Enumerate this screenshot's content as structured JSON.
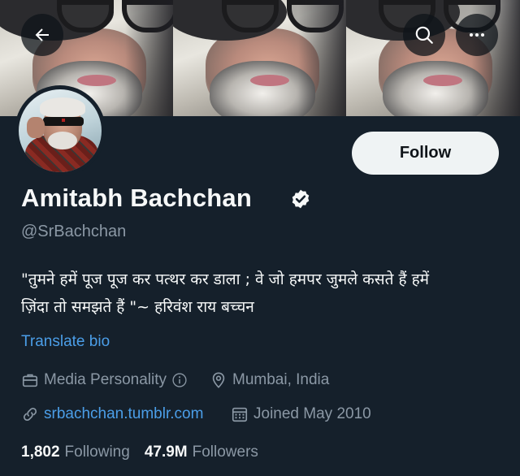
{
  "header": {
    "back_icon": "arrow-left-icon",
    "search_icon": "search-icon",
    "more_icon": "more-horizontal-icon"
  },
  "profile": {
    "follow_label": "Follow",
    "name": "Amitabh Bachchan",
    "verified": true,
    "handle": "@SrBachchan",
    "bio_line1": "\"तुमने हमें पूज पूज कर पत्थर कर डाला ; वे जो हमपर जुमले कसते हैं हमें",
    "bio_line2": "ज़िंदा तो समझते हैं \"~ हरिवंश राय बच्चन",
    "translate_label": "Translate bio",
    "category": "Media Personality",
    "location": "Mumbai, India",
    "website": "srbachchan.tumblr.com",
    "joined": "Joined May 2010"
  },
  "stats": {
    "following_count": "1,802",
    "following_label": "Following",
    "followers_count": "47.9M",
    "followers_label": "Followers"
  },
  "colors": {
    "background": "#15202b",
    "link": "#4b9ee8",
    "muted": "#8b98a5",
    "button_bg": "#eff3f4"
  }
}
